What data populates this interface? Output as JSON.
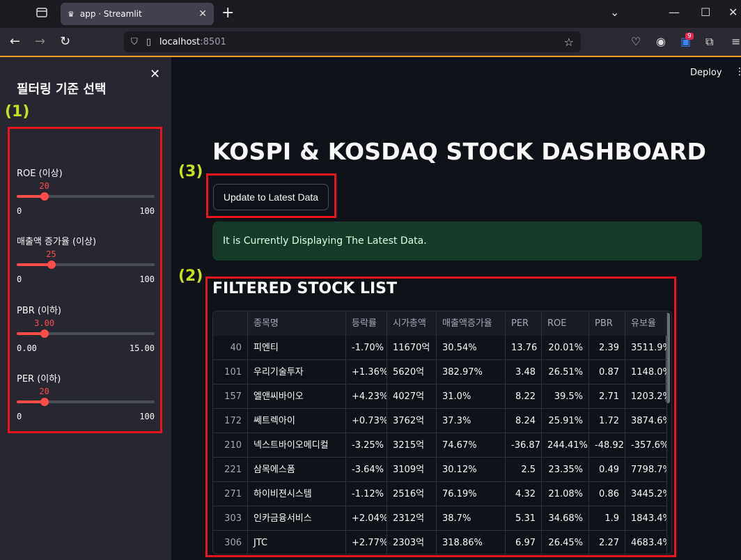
{
  "browser": {
    "tab_title": "app · Streamlit",
    "url_host": "localhost",
    "url_port": ":8501",
    "badge_count": "9"
  },
  "sidebar": {
    "title": "필터링 기준 선택",
    "sliders": [
      {
        "label": "ROE (이상)",
        "value": "20",
        "min": "0",
        "max": "100",
        "fraction": 0.2
      },
      {
        "label": "매출액 증가율 (이상)",
        "value": "25",
        "min": "0",
        "max": "100",
        "fraction": 0.25
      },
      {
        "label": "PBR (이하)",
        "value": "3.00",
        "min": "0.00",
        "max": "15.00",
        "fraction": 0.2
      },
      {
        "label": "PER (이하)",
        "value": "20",
        "min": "0",
        "max": "100",
        "fraction": 0.2
      }
    ]
  },
  "markers": {
    "m1": "(1)",
    "m2": "(2)",
    "m3": "(3)"
  },
  "header": {
    "deploy": "Deploy"
  },
  "main": {
    "title": "KOSPI & KOSDAQ STOCK DASHBOARD",
    "update_button": "Update to Latest Data",
    "alert": "It is Currently Displaying The Latest Data.",
    "list_title": "FILTERED STOCK LIST"
  },
  "table": {
    "columns": [
      "",
      "종목명",
      "등락률",
      "시가총액",
      "매출액증가율",
      "PER",
      "ROE",
      "PBR",
      "유보율"
    ],
    "rows": [
      [
        "40",
        "피엔티",
        "-1.70%",
        "11670억",
        "30.54%",
        "13.76",
        "20.01%",
        "2.39",
        "3511.9%"
      ],
      [
        "101",
        "우리기술투자",
        "+1.36%",
        "5620억",
        "382.97%",
        "3.48",
        "26.51%",
        "0.87",
        "1148.0%"
      ],
      [
        "157",
        "엘앤씨바이오",
        "+4.23%",
        "4027억",
        "31.0%",
        "8.22",
        "39.5%",
        "2.71",
        "1203.2%"
      ],
      [
        "172",
        "쎄트렉아이",
        "+0.73%",
        "3762억",
        "37.3%",
        "8.24",
        "25.91%",
        "1.72",
        "3874.6%"
      ],
      [
        "210",
        "넥스트바이오메디컬",
        "-3.25%",
        "3215억",
        "74.67%",
        "-36.87",
        "244.41%",
        "-48.92",
        "-357.6%"
      ],
      [
        "221",
        "삼목에스폼",
        "-3.64%",
        "3109억",
        "30.12%",
        "2.5",
        "23.35%",
        "0.49",
        "7798.7%"
      ],
      [
        "271",
        "하이비젼시스템",
        "-1.12%",
        "2516억",
        "76.19%",
        "4.32",
        "21.08%",
        "0.86",
        "3445.2%"
      ],
      [
        "303",
        "인카금융서비스",
        "+2.04%",
        "2312억",
        "38.7%",
        "5.31",
        "34.68%",
        "1.9",
        "1843.4%"
      ],
      [
        "306",
        "JTC",
        "+2.77%",
        "2303억",
        "318.86%",
        "6.97",
        "26.45%",
        "2.27",
        "4683.4%"
      ]
    ]
  }
}
